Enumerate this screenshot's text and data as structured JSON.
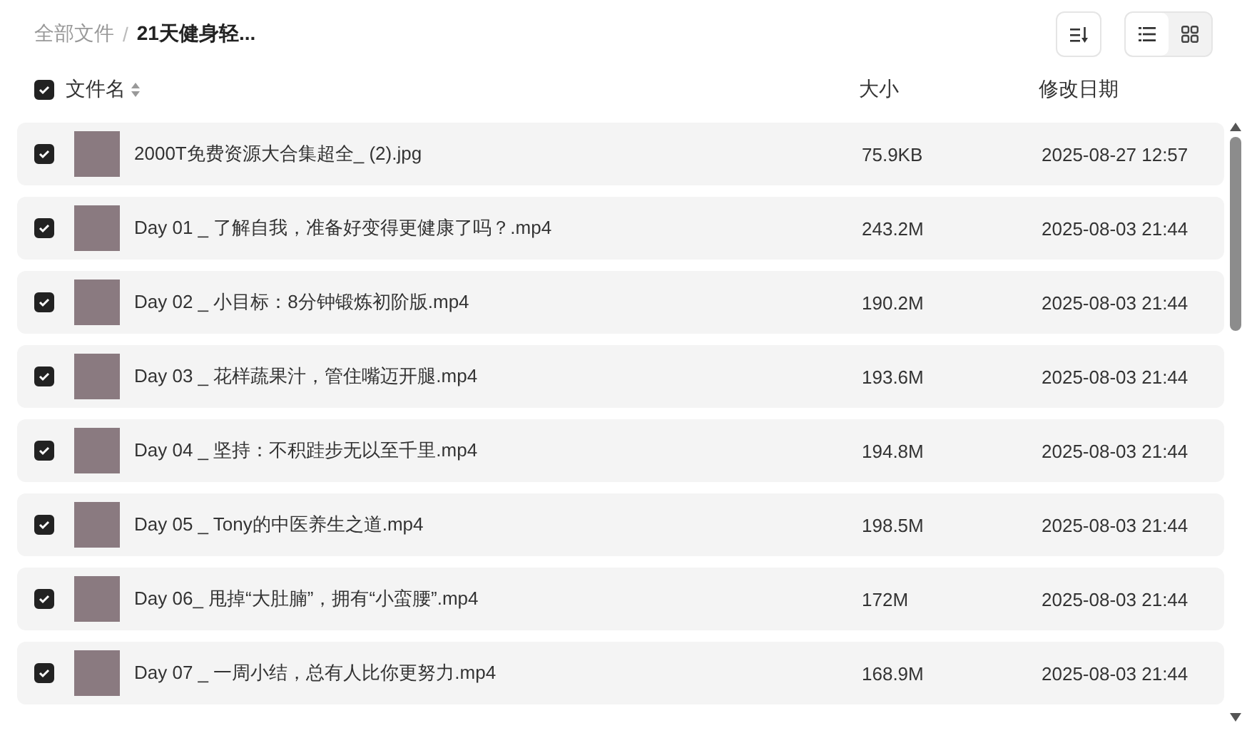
{
  "breadcrumb_separator": "/",
  "breadcrumb": [
    {
      "label": "全部文件",
      "current": false
    },
    {
      "label": "21天健身轻...",
      "current": true
    }
  ],
  "toolbar": {
    "view_modes": [
      {
        "kind": "list",
        "selected": true
      },
      {
        "kind": "grid",
        "selected": false
      }
    ]
  },
  "table": {
    "select_all": {
      "checked": true
    },
    "columns": [
      "文件名",
      "大小",
      "修改日期"
    ],
    "rows": [
      {
        "checked": true,
        "name": "2000T免费资源大合集超全_ (2).jpg",
        "size": "75.9KB",
        "modified": "2025-08-27 12:57"
      },
      {
        "checked": true,
        "name": "Day 01 _ 了解自我，准备好变得更健康了吗？.mp4",
        "size": "243.2M",
        "modified": "2025-08-03 21:44"
      },
      {
        "checked": true,
        "name": "Day 02 _ 小目标：8分钟锻炼初阶版.mp4",
        "size": "190.2M",
        "modified": "2025-08-03 21:44"
      },
      {
        "checked": true,
        "name": "Day 03 _ 花样蔬果汁，管住嘴迈开腿.mp4",
        "size": "193.6M",
        "modified": "2025-08-03 21:44"
      },
      {
        "checked": true,
        "name": "Day 04 _ 坚持：不积跬步无以至千里.mp4",
        "size": "194.8M",
        "modified": "2025-08-03 21:44"
      },
      {
        "checked": true,
        "name": "Day 05 _ Tony的中医养生之道.mp4",
        "size": "198.5M",
        "modified": "2025-08-03 21:44"
      },
      {
        "checked": true,
        "name": "Day 06_ 甩掉“大肚腩”，拥有“小蛮腰”.mp4",
        "size": "172M",
        "modified": "2025-08-03 21:44"
      },
      {
        "checked": true,
        "name": "Day 07 _ 一周小结，总有人比你更努力.mp4",
        "size": "168.9M",
        "modified": "2025-08-03 21:44"
      }
    ]
  }
}
